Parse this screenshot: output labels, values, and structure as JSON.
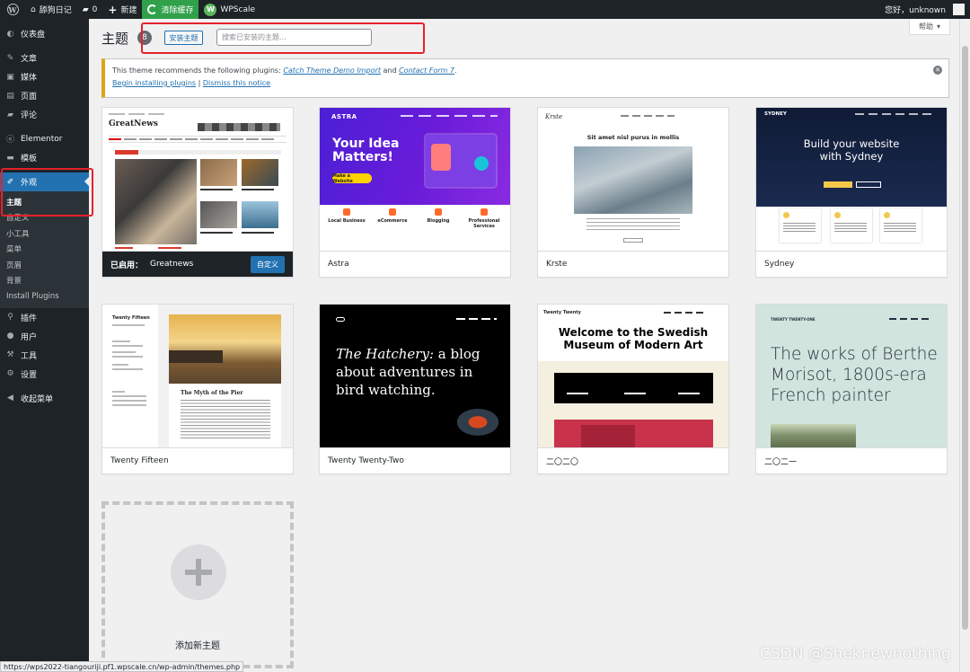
{
  "admin_bar": {
    "site_name": "舔狗日记",
    "comments_count": "0",
    "new_label": "新建",
    "cache_label": "清除缓存",
    "wpscale_label": "WPScale",
    "greeting": "您好，unknown"
  },
  "sidebar": {
    "items": [
      {
        "label": "仪表盘",
        "icon": "dashboard-icon"
      },
      {
        "label": "文章",
        "icon": "pin-icon"
      },
      {
        "label": "媒体",
        "icon": "media-icon"
      },
      {
        "label": "页面",
        "icon": "page-icon"
      },
      {
        "label": "评论",
        "icon": "comment-icon"
      },
      {
        "label": "Elementor",
        "icon": "elementor-icon"
      },
      {
        "label": "模板",
        "icon": "folder-icon"
      },
      {
        "label": "外观",
        "icon": "brush-icon"
      }
    ],
    "submenu": [
      "主题",
      "自定义",
      "小工具",
      "菜单",
      "页眉",
      "背景",
      "Install Plugins"
    ],
    "lower_items": [
      {
        "label": "插件",
        "icon": "plugin-icon"
      },
      {
        "label": "用户",
        "icon": "user-icon"
      },
      {
        "label": "工具",
        "icon": "wrench-icon"
      },
      {
        "label": "设置",
        "icon": "settings-icon"
      },
      {
        "label": "收起菜单",
        "icon": "collapse-icon"
      }
    ]
  },
  "help_tab": {
    "label": "帮助"
  },
  "page": {
    "title": "主题",
    "theme_count": "8",
    "add_button": "安装主题",
    "search_placeholder": "搜索已安装的主题..."
  },
  "notice": {
    "text_pre": "This theme recommends the following plugins: ",
    "plugin1": "Catch Theme Demo Import",
    "and": " and ",
    "plugin2": "Contact Form 7",
    "period": ".",
    "begin_link": "Begin installing plugins",
    "sep": " | ",
    "dismiss_link": "Dismiss this notice"
  },
  "themes": [
    {
      "name": "Greatnews",
      "active_label": "已启用：",
      "customize": "自定义",
      "shot": {
        "logo": "GreatNews"
      }
    },
    {
      "name": "Astra",
      "shot": {
        "brand": "ASTRA",
        "headline1": "Your Idea",
        "headline2": "Matters!",
        "button": "Make a Website",
        "features": [
          "Local Business",
          "eCommerce",
          "Blogging",
          "Professional Services"
        ]
      }
    },
    {
      "name": "Krste",
      "shot": {
        "logo": "Krste",
        "headline": "Sit amet nisl purus in mollis"
      }
    },
    {
      "name": "Sydney",
      "shot": {
        "logo": "SYDNEY",
        "headline1": "Build your website",
        "headline2": "with Sydney"
      }
    },
    {
      "name": "Twenty Fifteen",
      "shot": {
        "site": "Twenty Fifteen",
        "post_title": "The Myth of the Pier"
      }
    },
    {
      "name": "Twenty Twenty-Two",
      "shot": {
        "line1_em": "The Hatchery:",
        "line1": " a blog",
        "line2": "about adventures in",
        "line3": "bird watching."
      }
    },
    {
      "name": "二〇二〇",
      "shot": {
        "site": "Twenty Twenty",
        "headline1": "Welcome to the Swedish",
        "headline2": "Museum of Modern Art"
      }
    },
    {
      "name": "二〇二一",
      "shot": {
        "site": "TWENTY TWENTY-ONE",
        "headline": "The works of Berthe Morisot, 1800s-era French painter"
      }
    }
  ],
  "add_new": {
    "label": "添加新主题"
  },
  "status_url": "https://wps2022-tiangouriji.pf1.wpscale.cn/wp-admin/themes.php",
  "watermark": "CSDN @Sheknewnothing",
  "colors": {
    "accent": "#2271b1",
    "highlight_box": "#e5212b",
    "adminbar": "#1d2327",
    "notice_border": "#dba617"
  }
}
